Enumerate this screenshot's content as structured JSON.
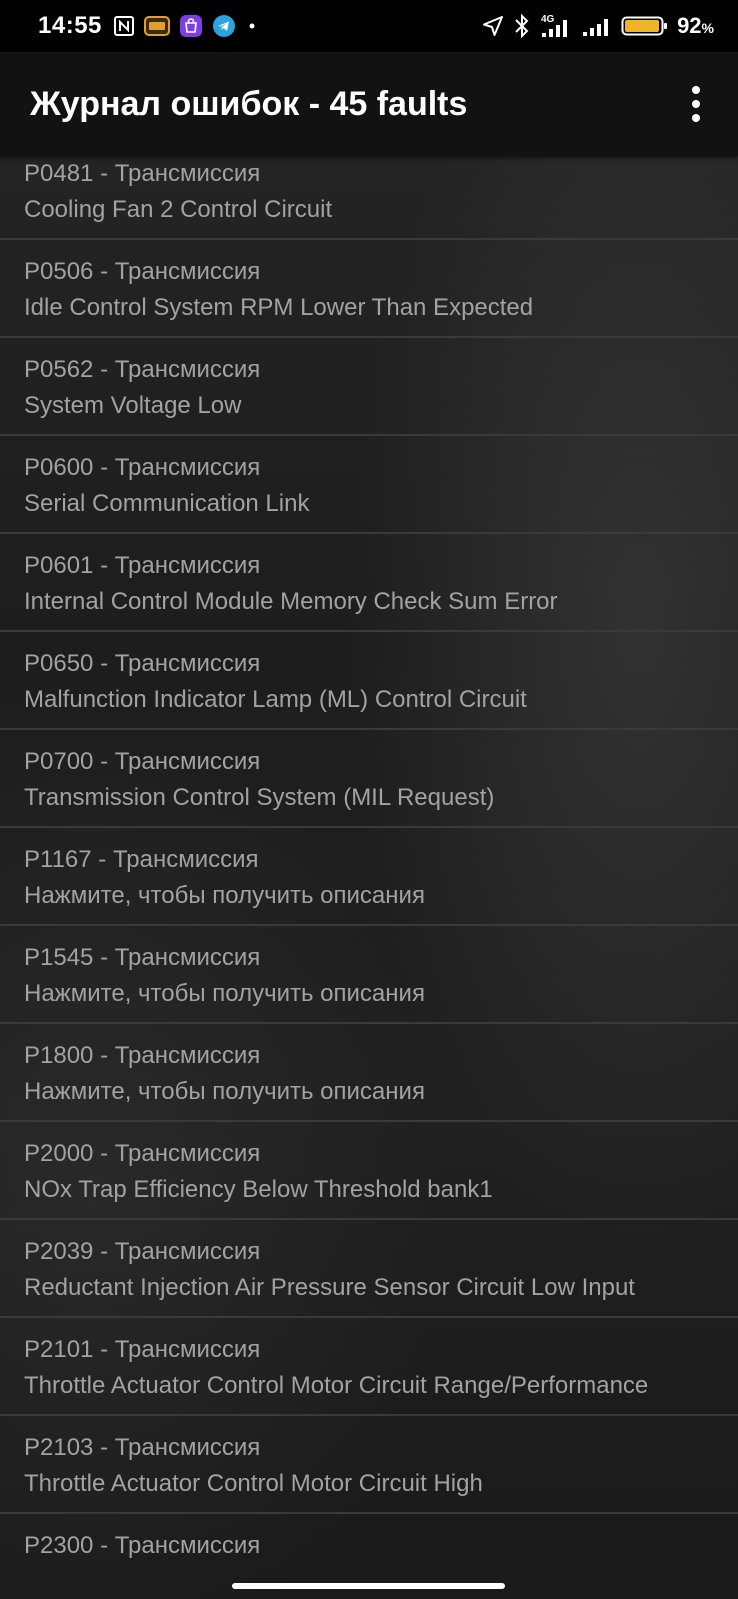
{
  "status_bar": {
    "time": "14:55",
    "network_type": "4G",
    "battery_percent": "92",
    "battery_unit": "%",
    "icons": [
      "nfc-icon",
      "obd-app-icon",
      "shopping-bag-icon",
      "telegram-icon",
      "dot-icon",
      "location-arrow-icon",
      "bluetooth-icon",
      "signal-4g-icon",
      "signal-icon",
      "battery-icon"
    ]
  },
  "app_bar": {
    "title": "Журнал ошибок - 45 faults",
    "menu_icon": "more-vertical-icon"
  },
  "faults": [
    {
      "code": "P0481 - Трансмиссия",
      "description": "Cooling Fan 2 Control Circuit"
    },
    {
      "code": "P0506 - Трансмиссия",
      "description": "Idle Control System RPM Lower Than Expected"
    },
    {
      "code": "P0562 - Трансмиссия",
      "description": "System Voltage Low"
    },
    {
      "code": "P0600 - Трансмиссия",
      "description": "Serial Communication Link"
    },
    {
      "code": "P0601 - Трансмиссия",
      "description": "Internal Control Module Memory Check Sum Error"
    },
    {
      "code": "P0650 - Трансмиссия",
      "description": "Malfunction Indicator Lamp (ML) Control Circuit"
    },
    {
      "code": "P0700 - Трансмиссия",
      "description": "Transmission Control System (MIL Request)"
    },
    {
      "code": "P1167 - Трансмиссия",
      "description": "Нажмите, чтобы получить описания"
    },
    {
      "code": "P1545 - Трансмиссия",
      "description": "Нажмите, чтобы получить описания"
    },
    {
      "code": "P1800 - Трансмиссия",
      "description": "Нажмите, чтобы получить описания"
    },
    {
      "code": "P2000 - Трансмиссия",
      "description": "NOx Trap Efficiency Below Threshold bank1"
    },
    {
      "code": "P2039 - Трансмиссия",
      "description": "Reductant Injection Air Pressure Sensor Circuit Low Input"
    },
    {
      "code": "P2101 - Трансмиссия",
      "description": "Throttle Actuator Control Motor Circuit Range/Performance"
    },
    {
      "code": "P2103 - Трансмиссия",
      "description": "Throttle Actuator Control Motor Circuit High"
    },
    {
      "code": "P2300 - Трансмиссия",
      "description": ""
    }
  ],
  "colors": {
    "status_bar_bg": "#000000",
    "app_bar_bg": "#121212",
    "title_text": "#ffffff",
    "item_text": "#a2a2a2",
    "divider": "#3a3a3a",
    "battery_fill": "#f0b429"
  }
}
